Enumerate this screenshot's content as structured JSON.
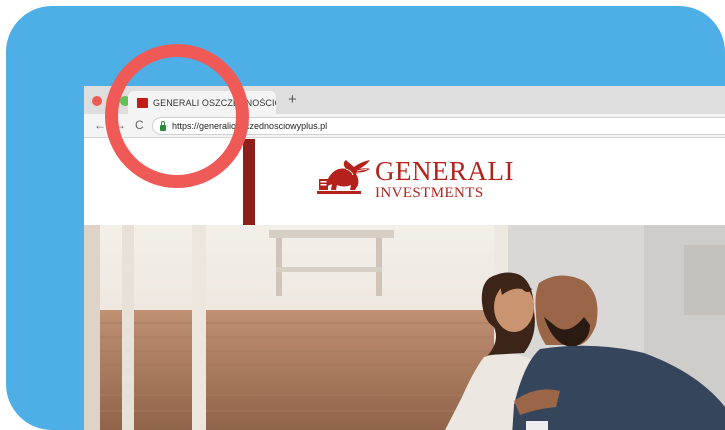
{
  "browser": {
    "tab": {
      "title": "GENERALI OSZCZĘDNOŚCIOWY",
      "favicon": "generali-favicon-icon"
    },
    "new_tab_symbol": "+",
    "nav": {
      "back": "←",
      "forward": "→",
      "reload": "C"
    },
    "address_bar": {
      "url": "https://generalioszczednosciowyplus.pl",
      "secure_icon": "lock-icon"
    }
  },
  "site": {
    "logo": {
      "line1": "GENERALI",
      "line2": "INVESTMENTS",
      "emblem": "winged-lion-icon"
    },
    "hero": {
      "image": "couple-sitting-by-window-photo"
    }
  },
  "colors": {
    "background_card": "#4dafe5",
    "highlight_circle": "#ef5a57",
    "brand_red": "#b5221b",
    "stripe": "#8e1f1a"
  }
}
